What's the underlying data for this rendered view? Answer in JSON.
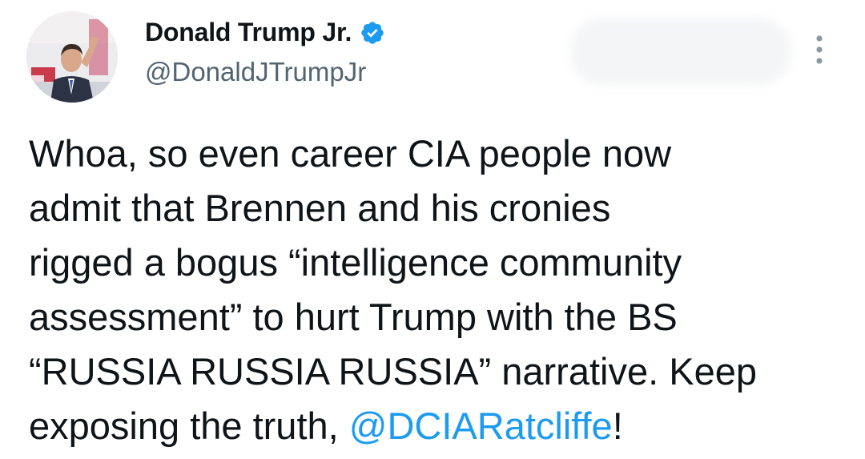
{
  "author": {
    "display_name": "Donald Trump Jr.",
    "handle": "@DonaldJTrumpJr",
    "verified": true,
    "verified_color": "#1d9bf0",
    "avatar_icon": "profile-photo"
  },
  "more_icon": "vertical-ellipsis-icon",
  "tweet": {
    "lines": [
      "Whoa, so even career CIA people now",
      "admit that Brennen and his cronies",
      "rigged a bogus “intelligence community",
      "assessment” to hurt Trump with the BS",
      "“RUSSIA RUSSIA RUSSIA” narrative. Keep"
    ],
    "last_line_prefix": "exposing the truth, ",
    "mention": "@DCIARatcliffe",
    "last_line_suffix": "!"
  },
  "colors": {
    "text": "#0f1419",
    "secondary": "#536471",
    "link": "#1d9bf0"
  }
}
